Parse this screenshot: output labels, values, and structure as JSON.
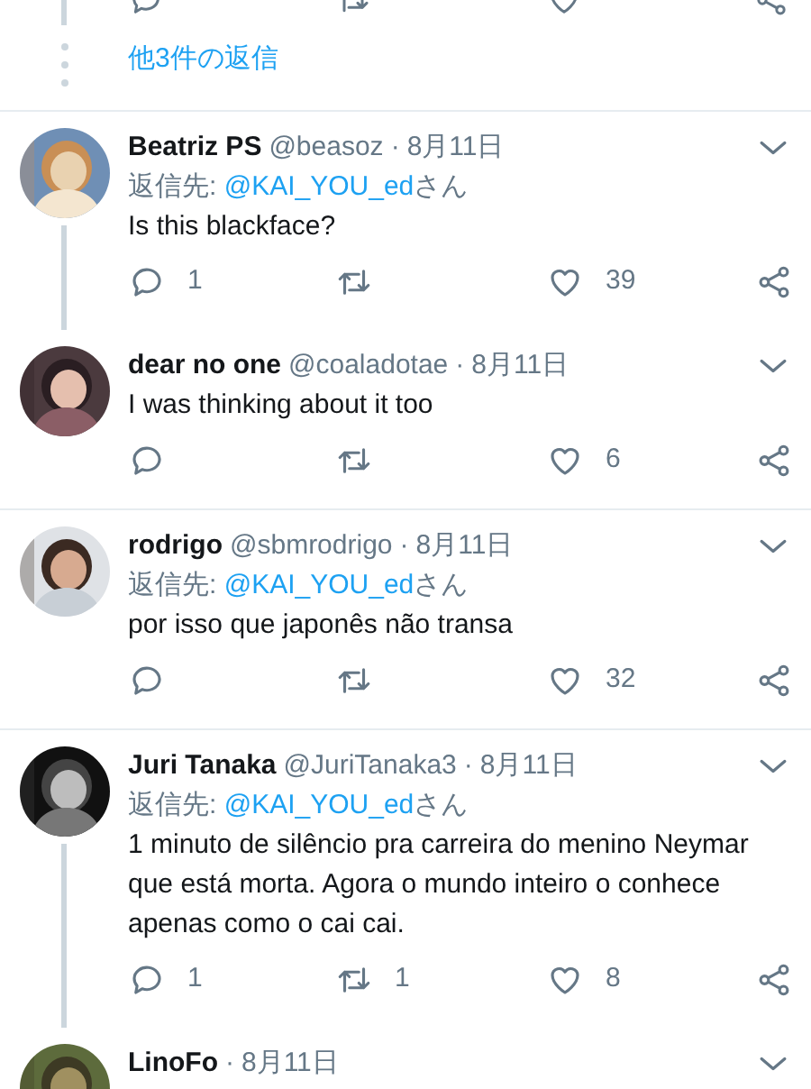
{
  "more_replies": {
    "label": "他3件の返信"
  },
  "tweets": [
    {
      "name": "Beatriz PS",
      "handle": "@beasoz",
      "separator": "·",
      "date": "8月11日",
      "reply_to": {
        "prefix": "返信先: ",
        "user": "@KAI_YOU_ed",
        "suffix": "さん"
      },
      "text": "Is this blackface?",
      "counts": {
        "reply": "1",
        "like": "39"
      },
      "thread_below": true
    },
    {
      "name": "dear no one",
      "handle": "@coaladotae",
      "separator": "·",
      "date": "8月11日",
      "text": "I was thinking about it too",
      "counts": {
        "like": "6"
      },
      "thread_below": false
    },
    {
      "name": "rodrigo",
      "handle": "@sbmrodrigo",
      "separator": "·",
      "date": "8月11日",
      "reply_to": {
        "prefix": "返信先: ",
        "user": "@KAI_YOU_ed",
        "suffix": "さん"
      },
      "text": "por isso que japonês não transa",
      "counts": {
        "like": "32"
      },
      "thread_below": false
    },
    {
      "name": "Juri Tanaka",
      "handle": "@JuriTanaka3",
      "separator": "·",
      "date": "8月11日",
      "reply_to": {
        "prefix": "返信先: ",
        "user": "@KAI_YOU_ed",
        "suffix": "さん"
      },
      "text": "1 minuto de silêncio pra carreira do menino Neymar que está morta. Agora o mundo inteiro o conhece apenas como o cai cai.",
      "counts": {
        "reply": "1",
        "retweet": "1",
        "like": "8"
      },
      "thread_below": true
    },
    {
      "name": "LinoFo",
      "separator": "·",
      "date": "8月11日",
      "thread_below": false
    }
  ]
}
